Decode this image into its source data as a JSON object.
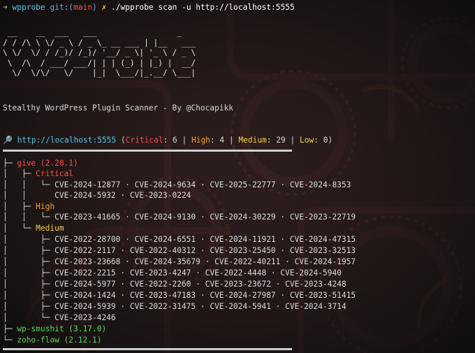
{
  "prompt": {
    "arrow": "➜",
    "dir": "wpprobe",
    "git_label": "git:(",
    "branch": "main",
    "git_close": ")",
    "dirty": "✗",
    "command": "./wpprobe scan -u http://localhost:5555"
  },
  "banner": {
    "ascii_art": " __    __  ___   ___                 _\n/ / /\\ \\ \\/ _ \\ / _ \\_ __ ___ | |__   ___\n\\ \\/  \\/ / /_)/ /_)/ '__/ _ \\| '_ \\ / _ \\\n \\  /\\  / ___/ ___/| | | (_) | |_) |  __/\n  \\/  \\/\\/   \\/    |_|  \\___/|_.__/ \\___|",
    "tagline": "Stealthy WordPress Plugin Scanner - By @Chocapikk"
  },
  "summary": {
    "icon": "magnifier-icon",
    "url": "http://localhost:5555",
    "open": " (",
    "critical_label": "Critical",
    "critical_count": "6",
    "high_label": "High",
    "high_count": "4",
    "medium_label": "Medium",
    "medium_count": "29",
    "low_label": "Low",
    "low_count": "0",
    "close": ")"
  },
  "tree": {
    "plugins": [
      {
        "name": "give (2.20.1)",
        "groups": [
          {
            "label": "Critical",
            "lines": [
              "CVE-2024-12877 · CVE-2024-9634 · CVE-2025-22777 · CVE-2024-8353",
              "CVE-2024-5932 · CVE-2023-0224"
            ]
          },
          {
            "label": "High",
            "lines": [
              "CVE-2023-41665 · CVE-2024-9130 · CVE-2024-30229 · CVE-2023-22719"
            ]
          },
          {
            "label": "Medium",
            "lines": [
              "CVE-2022-28700 · CVE-2024-6551 · CVE-2024-11921 · CVE-2024-47315",
              "CVE-2022-2117 · CVE-2022-40312 · CVE-2023-25450 · CVE-2023-32513",
              "CVE-2023-23668 · CVE-2024-35679 · CVE-2022-40211 · CVE-2024-1957",
              "CVE-2022-2215 · CVE-2023-4247 · CVE-2022-4448 · CVE-2024-5940",
              "CVE-2024-5977 · CVE-2022-2260 · CVE-2023-23672 · CVE-2023-4248",
              "CVE-2024-1424 · CVE-2023-47183 · CVE-2024-27987 · CVE-2023-51415",
              "CVE-2024-5939 · CVE-2022-31475 · CVE-2024-5941 · CVE-2024-3714",
              "CVE-2023-4246"
            ]
          }
        ]
      },
      {
        "name": "wp-smushit (3.17.0)"
      },
      {
        "name": "zoho-flow (2.12.1)"
      }
    ]
  },
  "colors": {
    "prompt_green": "#5ad65a",
    "url_cyan": "#55c7e6",
    "critical_red": "#ff4d4d",
    "high_orange": "#f0a23a",
    "medium_yellow": "#f2d24a",
    "plugin_green": "#5ad65a",
    "background": "#1a1616"
  }
}
